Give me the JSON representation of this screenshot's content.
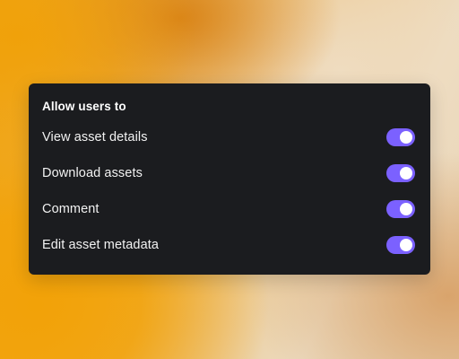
{
  "panel": {
    "title": "Allow users to",
    "toggle_color": "#7b61ff",
    "options": [
      {
        "label": "View asset details",
        "enabled": true
      },
      {
        "label": "Download assets",
        "enabled": true
      },
      {
        "label": "Comment",
        "enabled": true
      },
      {
        "label": "Edit asset metadata",
        "enabled": true
      }
    ]
  }
}
